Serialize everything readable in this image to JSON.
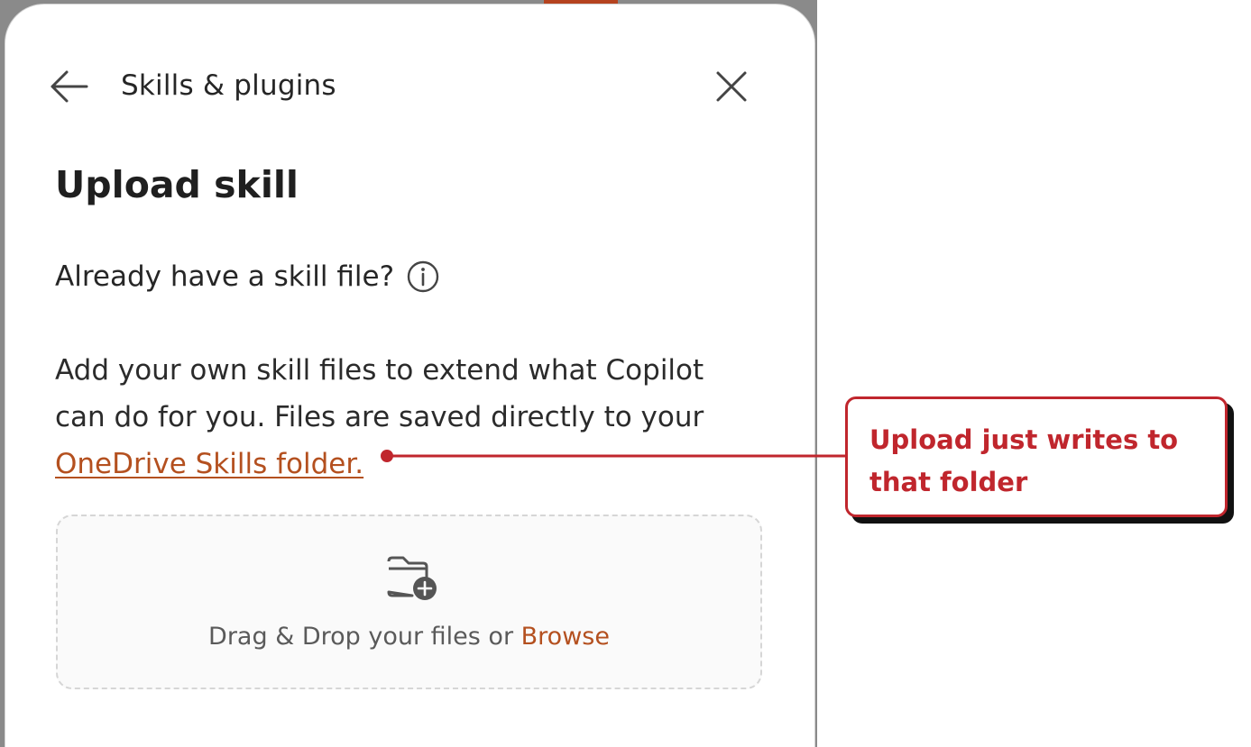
{
  "header": {
    "title": "Skills & plugins",
    "back_icon": "arrow-left-icon",
    "close_icon": "close-icon"
  },
  "main": {
    "title": "Upload skill",
    "subheading": "Already have a skill file?",
    "info_icon": "info-icon",
    "description": "Add your own skill files to extend what Copilot can do for you. Files are saved directly to your",
    "link_text": "OneDrive Skills folder."
  },
  "dropzone": {
    "icon": "folder-add-icon",
    "text": "Drag & Drop your files or",
    "browse_label": "Browse"
  },
  "annotation": {
    "text": "Upload just writes to that folder",
    "color": "#c0262d"
  },
  "colors": {
    "accent_link": "#b4501f",
    "annotation": "#c0262d"
  }
}
